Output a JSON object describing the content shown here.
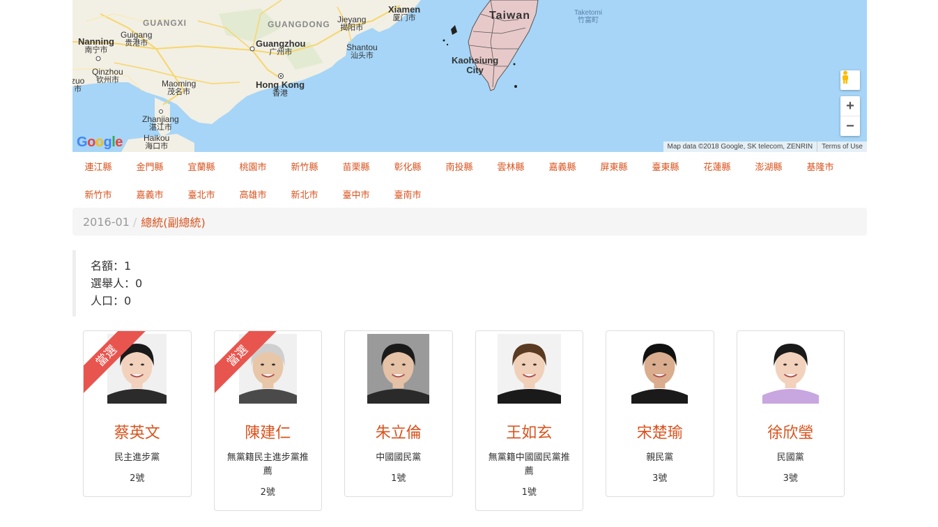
{
  "map": {
    "labels": {
      "nanning_en": "Nanning",
      "nanning_zh": "南宁市",
      "guigang_en": "Guigang",
      "guigang_zh": "贵港市",
      "guangxi": "GUANGXI",
      "guangdong": "GUANGDONG",
      "guangzhou_en": "Guangzhou",
      "guangzhou_zh": "广州市",
      "jieyang_en": "Jieyang",
      "jieyang_zh": "揭阳市",
      "shantou_en": "Shantou",
      "shantou_zh": "汕头市",
      "xiamen_en": "Xiamen",
      "xiamen_zh": "厦门市",
      "qinzhou_en": "Qinzhou",
      "qinzhou_zh": "钦州市",
      "maoming_en": "Maoming",
      "maoming_zh": "茂名市",
      "hongkong_en": "Hong Kong",
      "hongkong_zh": "香港",
      "zhanjiang_en": "Zhanjiang",
      "zhanjiang_zh": "湛江市",
      "haikou_en": "Haikou",
      "haikou_zh": "海口市",
      "taiwan": "Taiwan",
      "kaohsiung_en": "Kaohsiung",
      "kaohsiung_city": "City",
      "taketomi_en": "Taketomi",
      "taketomi_zh": "竹富町",
      "zuo": "zuo",
      "zuo_zh": "市"
    },
    "google": [
      "G",
      "o",
      "o",
      "g",
      "l",
      "e"
    ],
    "attribution": "Map data ©2018 Google, SK telecom, ZENRIN",
    "terms": "Terms of Use",
    "zoom_in": "+",
    "zoom_out": "−",
    "pegman_icon": "pegman-icon"
  },
  "counties_row1": [
    "連江縣",
    "金門縣",
    "宜蘭縣",
    "桃園市",
    "新竹縣",
    "苗栗縣",
    "彰化縣",
    "南投縣",
    "雲林縣",
    "嘉義縣",
    "屏東縣",
    "臺東縣",
    "花蓮縣",
    "澎湖縣",
    "基隆市"
  ],
  "counties_row2": [
    "新竹市",
    "嘉義市",
    "臺北市",
    "高雄市",
    "新北市",
    "臺中市",
    "臺南市"
  ],
  "breadcrumb": {
    "date": "2016-01",
    "separator": "/",
    "current": "總統(副總統)"
  },
  "info": {
    "seats": "名額：1",
    "voters": "選舉人：0",
    "population": "人口：0"
  },
  "elected_label": "當選",
  "candidates": [
    {
      "name": "蔡英文",
      "party": "民主進步黨",
      "number": "2號",
      "elected": true
    },
    {
      "name": "陳建仁",
      "party": "無黨籍民主進步黨推薦",
      "number": "2號",
      "elected": true
    },
    {
      "name": "朱立倫",
      "party": "中國國民黨",
      "number": "1號",
      "elected": false
    },
    {
      "name": "王如玄",
      "party": "無黨籍中國國民黨推薦",
      "number": "1號",
      "elected": false
    },
    {
      "name": "宋楚瑜",
      "party": "親民黨",
      "number": "3號",
      "elected": false
    },
    {
      "name": "徐欣瑩",
      "party": "民國黨",
      "number": "3號",
      "elected": false
    }
  ],
  "colors": {
    "accent": "#d9531e",
    "ribbon": "#e8554e",
    "water": "#a6d5f7",
    "land": "#f2efe4"
  }
}
